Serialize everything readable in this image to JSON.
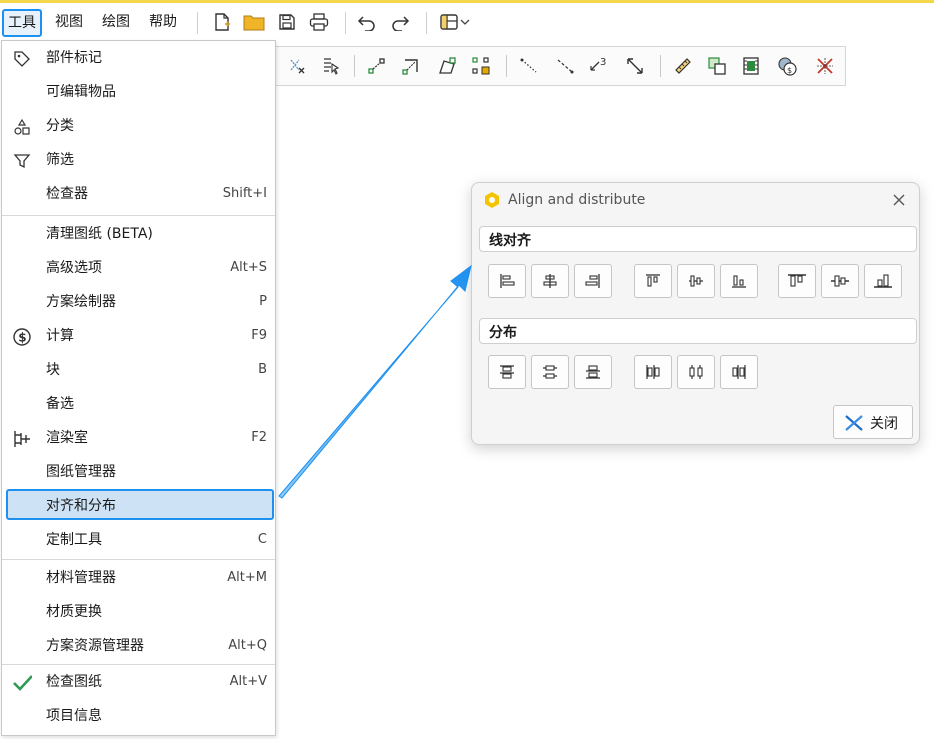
{
  "menubar": {
    "items": [
      {
        "label": "工具",
        "active": true
      },
      {
        "label": "视图"
      },
      {
        "label": "绘图"
      },
      {
        "label": "帮助"
      }
    ],
    "toolbar_icons": [
      "new-file-icon",
      "open-folder-icon",
      "save-icon",
      "print-icon",
      "undo-icon",
      "redo-icon",
      "layout-icon",
      "chevron-down-icon"
    ]
  },
  "drawing_toolbar": {
    "icons": [
      "select-remove-icon",
      "select-list-icon",
      "connect-points-icon",
      "corner-line-icon",
      "shape-edit-icon",
      "grid-points-icon",
      "dotted-line-icon",
      "dashed-line-icon",
      "dimension-3-icon",
      "measure-diagonal-icon",
      "ruler-icon",
      "copy-block-icon",
      "film-block-icon",
      "cost-gear-icon",
      "delete-cross-icon"
    ]
  },
  "menu": {
    "items": [
      {
        "label": "部件标记",
        "shortcut": "",
        "icon": "tag-icon"
      },
      {
        "label": "可编辑物品",
        "shortcut": ""
      },
      {
        "label": "分类",
        "shortcut": "",
        "icon": "shapes-icon"
      },
      {
        "label": "筛选",
        "shortcut": "",
        "icon": "filter-icon"
      },
      {
        "label": "检查器",
        "shortcut": "Shift+I"
      },
      {
        "label": "清理图纸 (BETA)",
        "shortcut": ""
      },
      {
        "label": "高级选项",
        "shortcut": "Alt+S"
      },
      {
        "label": "方案绘制器",
        "shortcut": "P"
      },
      {
        "label": "计算",
        "shortcut": "F9",
        "icon": "dollar-icon"
      },
      {
        "label": "块",
        "shortcut": "B"
      },
      {
        "label": "备选",
        "shortcut": ""
      },
      {
        "label": "渲染室",
        "shortcut": "F2",
        "icon": "render-room-icon"
      },
      {
        "label": "图纸管理器",
        "shortcut": ""
      },
      {
        "label": "对齐和分布",
        "shortcut": "",
        "highlighted": true
      },
      {
        "label": "定制工具",
        "shortcut": "C"
      },
      {
        "label": "材料管理器",
        "shortcut": "Alt+M"
      },
      {
        "label": "材质更换",
        "shortcut": ""
      },
      {
        "label": "方案资源管理器",
        "shortcut": "Alt+Q"
      },
      {
        "label": "检查图纸",
        "shortcut": "Alt+V",
        "icon": "check-icon"
      },
      {
        "label": "项目信息",
        "shortcut": ""
      }
    ]
  },
  "dialog": {
    "title": "Align and distribute",
    "section_align": "线对齐",
    "section_distribute": "分布",
    "close_label": "关闭",
    "align_buttons": [
      "align-left-icon",
      "align-center-h-icon",
      "align-right-icon",
      "align-top-icon",
      "align-middle-v-icon",
      "align-bottom-icon",
      "align-top-edge-icon",
      "align-center-edge-icon",
      "align-bottom-edge-icon"
    ],
    "distribute_buttons": [
      "distribute-top-icon",
      "distribute-center-v-icon",
      "distribute-bottom-icon",
      "distribute-left-icon",
      "distribute-center-h-icon",
      "distribute-right-icon"
    ]
  },
  "colors": {
    "accent": "#1e90f0",
    "highlight_bg": "#cde3f5",
    "top_strip": "#f3d64a",
    "dialog_icon": "#f5c400",
    "check": "#2e9a52"
  }
}
